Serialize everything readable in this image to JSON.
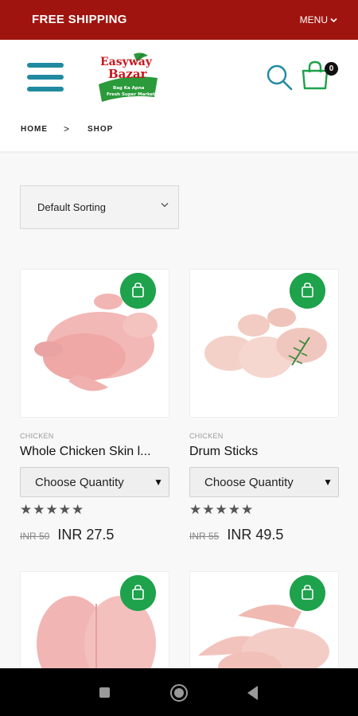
{
  "topbar": {
    "shipping": "FREE SHIPPING",
    "menu": "MENU"
  },
  "header": {
    "logo_line1": "Easyway",
    "logo_line2": "Bazar",
    "logo_tag1": "Bag Ka Apna",
    "logo_tag2": "Fresh Super Market",
    "cart_count": "0"
  },
  "breadcrumb": {
    "home": "HOME",
    "separator": ">",
    "current": "SHOP"
  },
  "sorting": {
    "selected": "Default Sorting"
  },
  "products": [
    {
      "category": "CHICKEN",
      "name": "Whole Chicken Skin l...",
      "quantity_placeholder": "Choose Quantity",
      "stars": "★★★★★",
      "old_price": "INR 50",
      "price": "INR 27.5"
    },
    {
      "category": "CHICKEN",
      "name": "Drum Sticks",
      "quantity_placeholder": "Choose Quantity",
      "stars": "★★★★★",
      "old_price": "INR 55",
      "price": "INR 49.5"
    }
  ],
  "colors": {
    "brand_red": "#a0140f",
    "accent_teal": "#1f8aa0",
    "cart_green": "#1ea24c"
  },
  "icons": [
    "menu-icon",
    "search-icon",
    "cart-icon",
    "shopping-bag-icon",
    "chevron-down-icon"
  ]
}
